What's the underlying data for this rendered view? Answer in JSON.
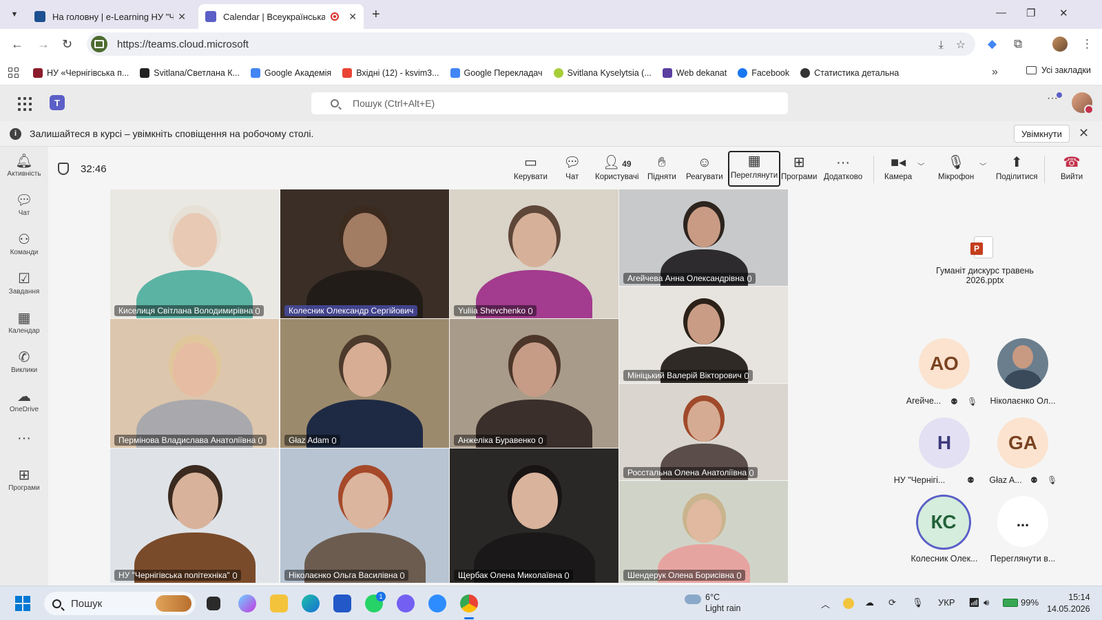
{
  "browser": {
    "tabs": [
      {
        "title": "На головну | e-Learning НУ \"Че",
        "active": false
      },
      {
        "title": "Calendar | Всеукраїнська н",
        "active": true
      }
    ],
    "url": "https://teams.cloud.microsoft",
    "bookmarks": [
      {
        "label": "НУ «Чернігівська п...",
        "color": "#8b1c2b"
      },
      {
        "label": "Svitlana/Светлана К...",
        "color": "#222222"
      },
      {
        "label": "Google Академія",
        "color": "#4285f4"
      },
      {
        "label": "Вхідні (12) - ksvim3...",
        "color": "#ea4335"
      },
      {
        "label": "Google Перекладач",
        "color": "#4285f4"
      },
      {
        "label": "Svitlana Kyselytsia (...",
        "color": "#a6ce39"
      },
      {
        "label": "Web dekanat",
        "color": "#5b3fa0"
      },
      {
        "label": "Facebook",
        "color": "#1877f2"
      },
      {
        "label": "Статистика детальна",
        "color": "#333333"
      }
    ],
    "all_bookmarks": "Усі закладки"
  },
  "teams": {
    "search_placeholder": "Пошук (Ctrl+Alt+E)",
    "notification": {
      "message": "Залишайтеся в курсі – увімкніть сповіщення на робочому столі.",
      "enable_label": "Увімкнути"
    },
    "rail": [
      {
        "label": "Активність",
        "icon": "bell-icon"
      },
      {
        "label": "Чат",
        "icon": "chat-icon"
      },
      {
        "label": "Команди",
        "icon": "teams-icon"
      },
      {
        "label": "Завдання",
        "icon": "tasks-icon"
      },
      {
        "label": "Календар",
        "icon": "calendar-icon"
      },
      {
        "label": "Виклики",
        "icon": "phone-icon"
      },
      {
        "label": "OneDrive",
        "icon": "cloud-icon"
      },
      {
        "label": "Програми",
        "icon": "apps-icon"
      }
    ]
  },
  "meeting": {
    "timer": "32:46",
    "controls": {
      "manage": "Керувати",
      "chat": "Чат",
      "people": "Користувачі",
      "people_count": "49",
      "raise": "Підняти",
      "react": "Реагувати",
      "view": "Переглянути",
      "apps": "Програми",
      "more": "Додатково",
      "camera": "Камера",
      "mic": "Мікрофон",
      "share": "Поділитися",
      "leave": "Вийти"
    },
    "participants": [
      {
        "name": "Киселиця Світлана Володимирівна",
        "bg": "#eae8e2",
        "shirt": "#5bb3a4",
        "skin": "#e8c9b4",
        "hair": "#e6e0d6"
      },
      {
        "name": "Колесник Олександр Сергійович",
        "bg": "#3a2e26",
        "shirt": "#221c18",
        "skin": "#a27c63",
        "hair": "#3b2a1e",
        "active": true
      },
      {
        "name": "Yuliia Shevchenko",
        "bg": "#d9d3c8",
        "shirt": "#a33b8e",
        "skin": "#d7b09a",
        "hair": "#5e4638"
      },
      {
        "name": "Агейчева Анна Олександрівна",
        "bg": "#c7c9cb",
        "shirt": "#2d2b2e",
        "skin": "#c99b84",
        "hair": "#2d241e"
      },
      {
        "name": "Мініцький Валерій Вікторович",
        "bg": "#e7e4df",
        "shirt": "#302a26",
        "skin": "#c99c85",
        "hair": "#2c2118"
      },
      {
        "name": "Пермінова Владислава Анатоліївна",
        "bg": "#dcc6ad",
        "shirt": "#a9a9ad",
        "skin": "#e6bca2",
        "hair": "#e0c79b"
      },
      {
        "name": "Głaz Adam",
        "bg": "#9c8a6c",
        "shirt": "#1e2a44",
        "skin": "#d7ad94",
        "hair": "#4c3a2c"
      },
      {
        "name": "Анжеліка Буравенко",
        "bg": "#a99b8a",
        "shirt": "#3a2f2a",
        "skin": "#c69c86",
        "hair": "#4b3629"
      },
      {
        "name": "Росстальна Олена Анатоліївна",
        "bg": "#dad6cf",
        "shirt": "#5a4d4a",
        "skin": "#d6ab93",
        "hair": "#a04a2b"
      },
      {
        "name": "НУ \"Чернігівська політехніка\"",
        "bg": "#dfe3e8",
        "shirt": "#7a4b2a",
        "skin": "#d8b29b",
        "hair": "#3b2a1f"
      },
      {
        "name": "Ніколаєнко Ольга Василівна",
        "bg": "#b8c4d2",
        "shirt": "#6c5c50",
        "skin": "#dbb59d",
        "hair": "#a5492a"
      },
      {
        "name": "Щербак Олена Миколаївна",
        "bg": "#2a2826",
        "shirt": "#1a1818",
        "skin": "#d9b39b",
        "hair": "#181414"
      },
      {
        "name": "Шендерук Олена Борисівна",
        "bg": "#d0d4c8",
        "shirt": "#e6a4a0",
        "skin": "#e0b9a0",
        "hair": "#c9b48e"
      }
    ],
    "shared_file": "Гуманіт дискурс травень 2026.pptx",
    "side_participants": [
      {
        "initials": "АО",
        "name": "Агейче...",
        "bg": "#fbe3cf",
        "fg": "#7a4221"
      },
      {
        "initials": "",
        "name": "Ніколаєнко Ол...",
        "bg": "#6a7e8e",
        "fg": "#ffffff"
      },
      {
        "initials": "Н",
        "name": "НУ \"Чернігі...",
        "bg": "#e3e0f3",
        "fg": "#3c3a7a"
      },
      {
        "initials": "GA",
        "name": "Głaz A...",
        "bg": "#fbe3cf",
        "fg": "#7a4221"
      },
      {
        "initials": "КС",
        "name": "Колесник Олек...",
        "bg": "#d4eddc",
        "fg": "#23603a"
      },
      {
        "initials": "...",
        "name": "Переглянути в...",
        "bg": "#ffffff",
        "fg": "#242424"
      }
    ]
  },
  "taskbar": {
    "search": "Пошук",
    "weather_temp": "6°C",
    "weather_desc": "Light rain",
    "lang": "УКР",
    "battery": "99%",
    "time": "15:14",
    "date": "14.05.2026",
    "whatsapp_badge": "1"
  }
}
